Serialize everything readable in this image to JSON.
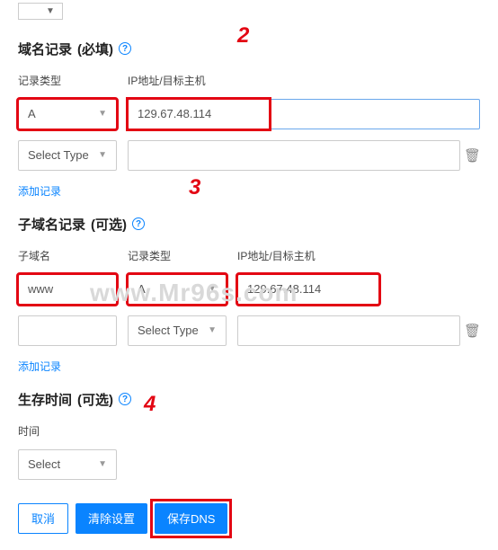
{
  "top_select_placeholder": "",
  "sections": {
    "domain_records": {
      "title": "域名记录",
      "required_tag": "(必填)",
      "fields": {
        "type_label": "记录类型",
        "ip_label": "IP地址/目标主机"
      },
      "row1": {
        "type_value": "A",
        "ip_value": "129.67.48.114"
      },
      "row2": {
        "type_placeholder": "Select Type",
        "ip_value": ""
      },
      "add_link": "添加记录"
    },
    "sub_records": {
      "title": "子域名记录",
      "optional_tag": "(可选)",
      "fields": {
        "sub_label": "子域名",
        "type_label": "记录类型",
        "ip_label": "IP地址/目标主机"
      },
      "row1": {
        "sub_value": "www",
        "type_value": "A",
        "ip_value": "129.67.48.114"
      },
      "row2": {
        "sub_value": "",
        "type_placeholder": "Select Type",
        "ip_value": ""
      },
      "add_link": "添加记录"
    },
    "ttl": {
      "title": "生存时间",
      "optional_tag": "(可选)",
      "label": "时间",
      "select_placeholder": "Select"
    }
  },
  "buttons": {
    "cancel": "取消",
    "clear": "清除设置",
    "save": "保存DNS"
  },
  "markers": {
    "m2": "2",
    "m3": "3",
    "m4": "4"
  },
  "watermark": "www.Mr96s.com",
  "help_char": "?",
  "trash_char": "🗑"
}
